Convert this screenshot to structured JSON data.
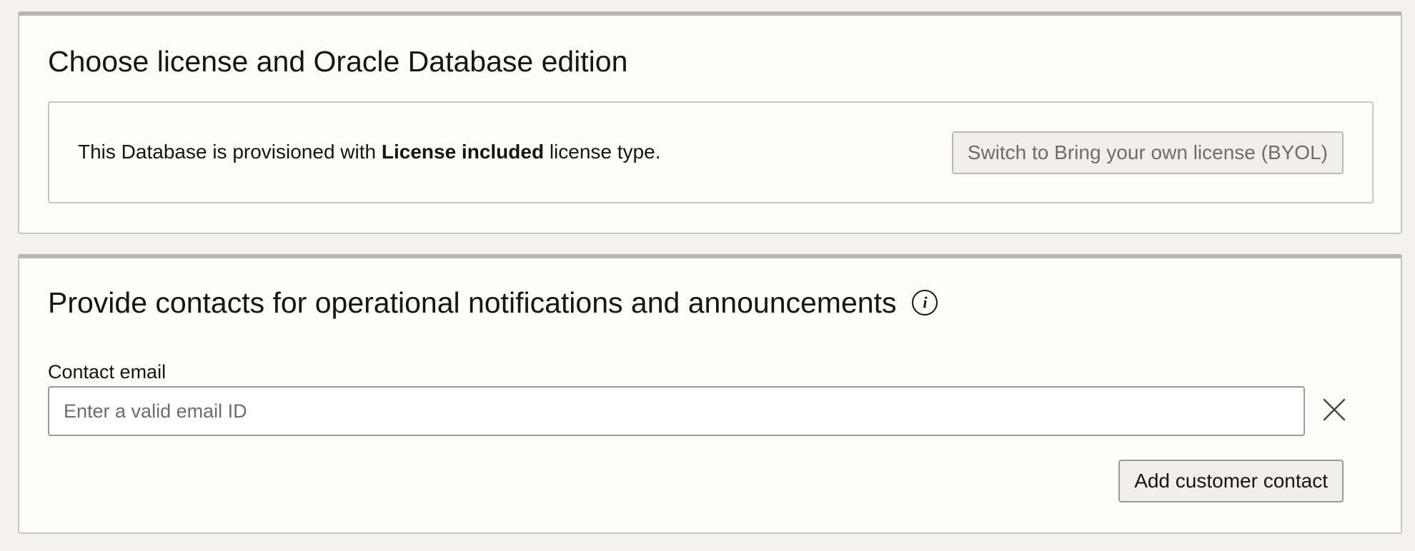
{
  "license_section": {
    "title": "Choose license and Oracle Database edition",
    "message_prefix": "This Database is provisioned with ",
    "message_bold": "License included",
    "message_suffix": " license type.",
    "switch_button_label": "Switch to Bring your own license (BYOL)"
  },
  "contacts_section": {
    "title": "Provide contacts for operational notifications and announcements",
    "info_icon_glyph": "i",
    "contact_email_label": "Contact email",
    "contact_email_value": "",
    "contact_email_placeholder": "Enter a valid email ID",
    "remove_icon": "close-icon",
    "add_contact_button_label": "Add customer contact"
  }
}
